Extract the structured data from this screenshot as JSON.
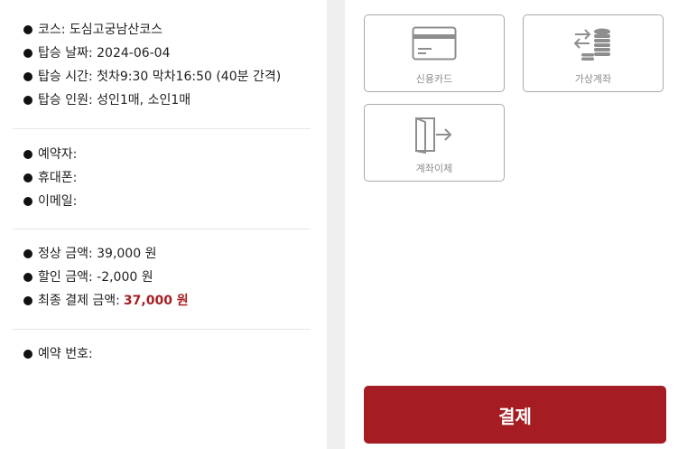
{
  "trip": {
    "course": "코스: 도심고궁남산코스",
    "date": "탑승 날짜: 2024-06-04",
    "time": "탑승 시간: 첫차9:30 막차16:50 (40분 간격)",
    "people": "탑승 인원: 성인1매, 소인1매"
  },
  "contact": {
    "reserver": "예약자:",
    "phone": "휴대폰:",
    "email": "이메일:"
  },
  "price": {
    "regular": "정상 금액: 39,000 원",
    "discount": "할인 금액: -2,000 원",
    "final_label": "최종 결제 금액:",
    "final_value": "37,000 원"
  },
  "reservation": {
    "number": "예약 번호:"
  },
  "payment_methods": [
    {
      "label": "신용카드",
      "icon": "credit-card-icon"
    },
    {
      "label": "가상계좌",
      "icon": "coin-stack-icon"
    },
    {
      "label": "계좌이체",
      "icon": "door-transfer-icon"
    }
  ],
  "pay_button": "결제",
  "colors": {
    "accent": "#a51d22",
    "final_price": "#a61e22",
    "divider_column": "#efefef",
    "option_border": "#a9a9a9"
  }
}
